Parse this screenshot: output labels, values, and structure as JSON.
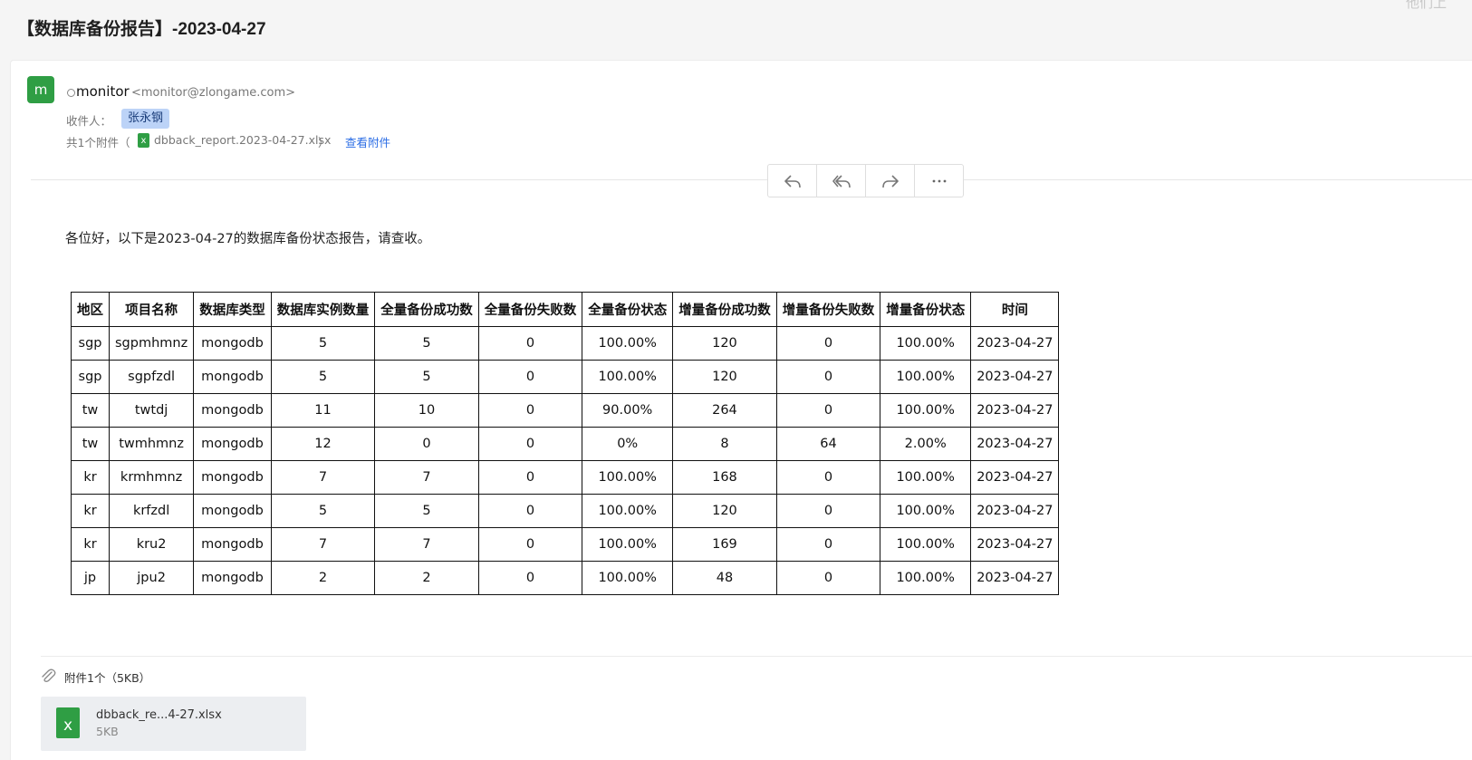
{
  "subject": "【数据库备份报告】-2023-04-27",
  "corner_text": "他们上",
  "sender": {
    "avatar_letter": "m",
    "name": "monitor",
    "email": "<monitor@zlongame.com>"
  },
  "recipients": {
    "label": "收件人：",
    "names": [
      "张永钢"
    ]
  },
  "attachment_row": {
    "prefix": "共1个附件（",
    "file_name": "dbback_report.2023-04-27.xlsx",
    "suffix": "）",
    "view_link": "查看附件"
  },
  "toolbar": {
    "icons": [
      "reply-icon",
      "reply-all-icon",
      "forward-icon",
      "more-icon"
    ]
  },
  "body": {
    "greeting": "各位好，以下是2023-04-27的数据库备份状态报告，请查收。"
  },
  "table": {
    "headers": [
      "地区",
      "项目名称",
      "数据库类型",
      "数据库实例数量",
      "全量备份成功数",
      "全量备份失败数",
      "全量备份状态",
      "增量备份成功数",
      "增量备份失败数",
      "增量备份状态",
      "时间"
    ],
    "rows": [
      [
        "sgp",
        "sgpmhmnz",
        "mongodb",
        "5",
        "5",
        "0",
        "100.00%",
        "120",
        "0",
        "100.00%",
        "2023-04-27"
      ],
      [
        "sgp",
        "sgpfzdl",
        "mongodb",
        "5",
        "5",
        "0",
        "100.00%",
        "120",
        "0",
        "100.00%",
        "2023-04-27"
      ],
      [
        "tw",
        "twtdj",
        "mongodb",
        "11",
        "10",
        "0",
        "90.00%",
        "264",
        "0",
        "100.00%",
        "2023-04-27"
      ],
      [
        "tw",
        "twmhmnz",
        "mongodb",
        "12",
        "0",
        "0",
        "0%",
        "8",
        "64",
        "2.00%",
        "2023-04-27"
      ],
      [
        "kr",
        "krmhmnz",
        "mongodb",
        "7",
        "7",
        "0",
        "100.00%",
        "168",
        "0",
        "100.00%",
        "2023-04-27"
      ],
      [
        "kr",
        "krfzdl",
        "mongodb",
        "5",
        "5",
        "0",
        "100.00%",
        "120",
        "0",
        "100.00%",
        "2023-04-27"
      ],
      [
        "kr",
        "kru2",
        "mongodb",
        "7",
        "7",
        "0",
        "100.00%",
        "169",
        "0",
        "100.00%",
        "2023-04-27"
      ],
      [
        "jp",
        "jpu2",
        "mongodb",
        "2",
        "2",
        "0",
        "100.00%",
        "48",
        "0",
        "100.00%",
        "2023-04-27"
      ]
    ]
  },
  "attachments_footer": {
    "count_label": "附件1个（5KB）",
    "file_display_name": "dbback_re...4-27.xlsx",
    "file_size": "5KB",
    "file_icon": "excel-icon"
  },
  "colors": {
    "avatar": "#2f9e44",
    "excel": "#2f9e44",
    "link": "#2b6de5",
    "chip": "#bcd3f7"
  }
}
